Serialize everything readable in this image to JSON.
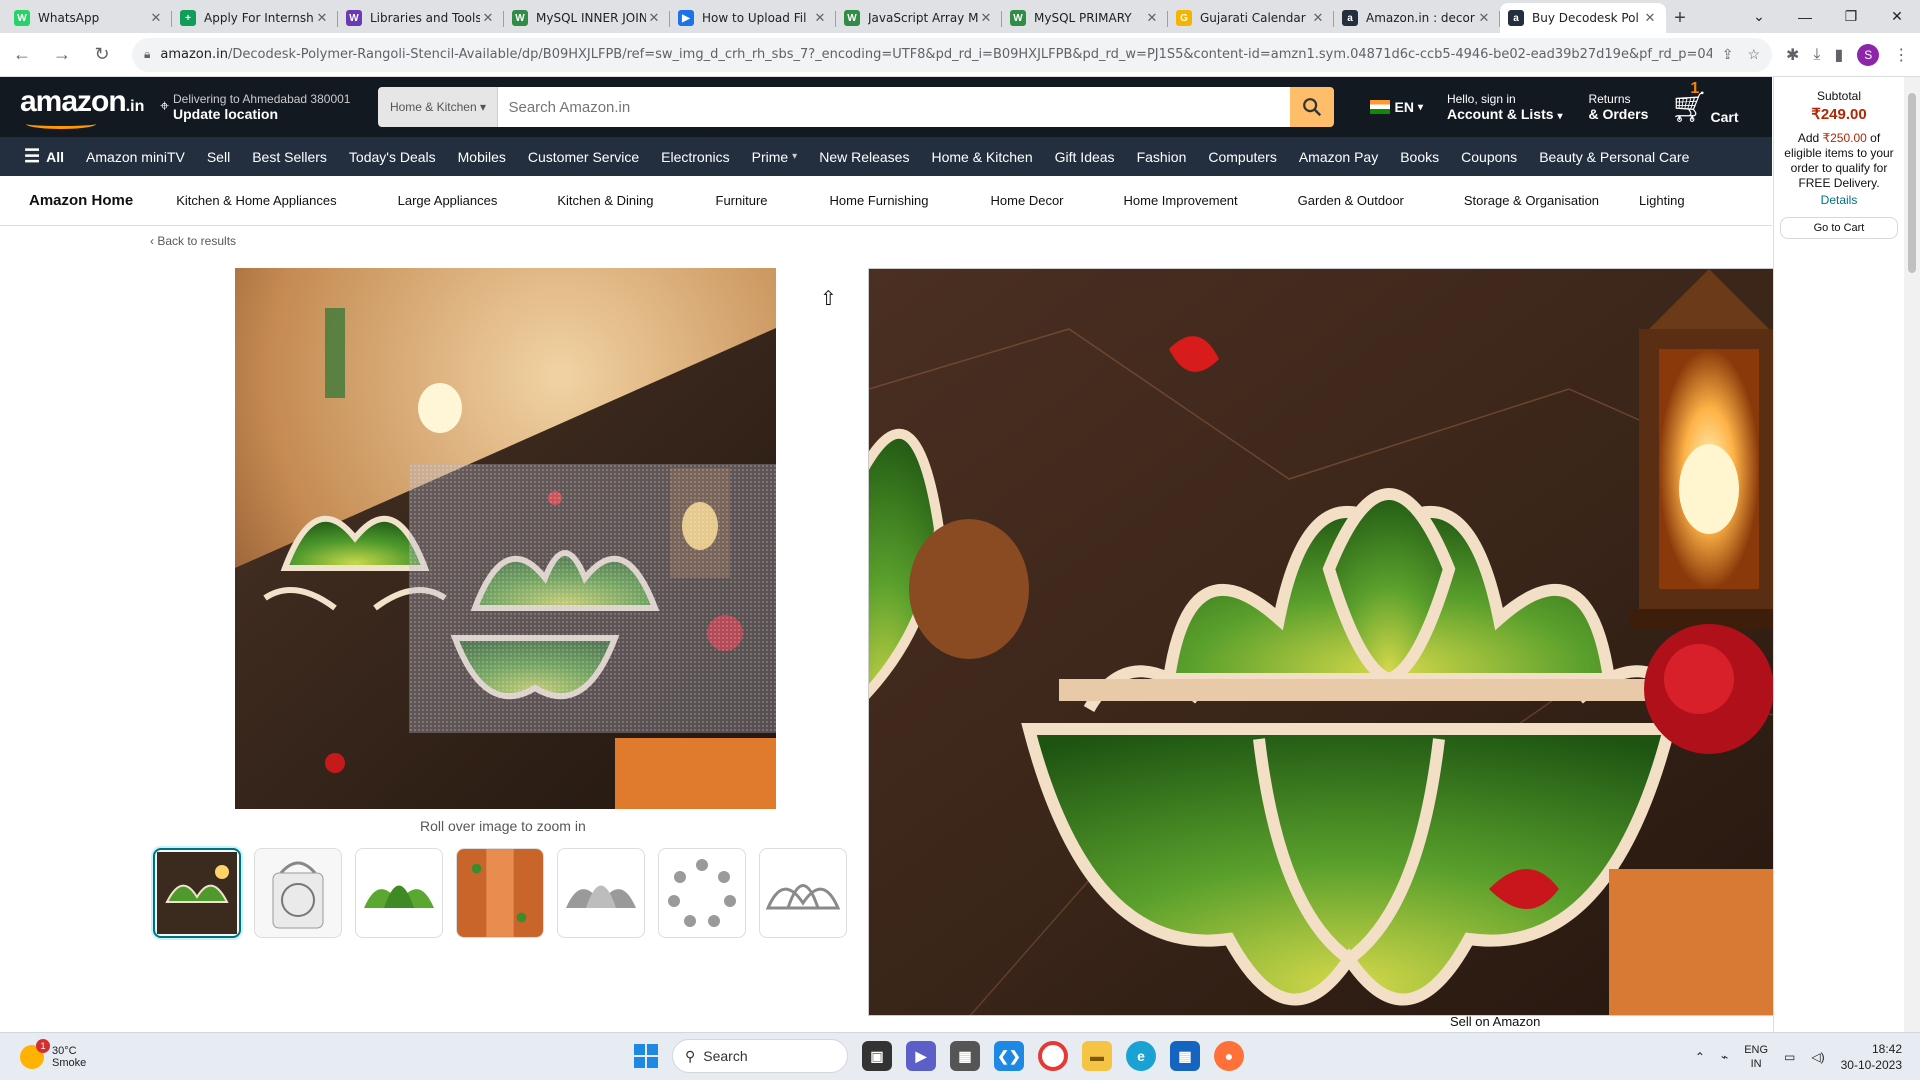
{
  "browser": {
    "tabs": [
      {
        "title": "WhatsApp",
        "color": "#25d366",
        "glyph": "W"
      },
      {
        "title": "Apply For Internsh",
        "color": "#0f9d58",
        "glyph": "+"
      },
      {
        "title": "Libraries and Tools",
        "color": "#6a3ab2",
        "glyph": "W"
      },
      {
        "title": "MySQL INNER JOIN",
        "color": "#2f8d46",
        "glyph": "W"
      },
      {
        "title": "How to Upload Fil",
        "color": "#1a73e8",
        "glyph": "▶"
      },
      {
        "title": "JavaScript Array M",
        "color": "#2f8d46",
        "glyph": "W"
      },
      {
        "title": "MySQL PRIMARY",
        "color": "#2f8d46",
        "glyph": "W"
      },
      {
        "title": "Gujarati Calendar",
        "color": "#f4b400",
        "glyph": "G"
      },
      {
        "title": "Amazon.in : decor",
        "color": "#232f3e",
        "glyph": "a"
      },
      {
        "title": "Buy Decodesk Pol",
        "color": "#232f3e",
        "glyph": "a"
      }
    ],
    "active_tab": 9,
    "url_host": "amazon.in",
    "url_path": "/Decodesk-Polymer-Rangoli-Stencil-Available/dp/B09HXJLFPB/ref=sw_img_d_crh_rh_sbs_7?_encoding=UTF8&pd_rd_i=B09HXJLFPB&pd_rd_w=PJ1S5&content-id=amzn1.sym.04871d6c-ccb5-4946-be02-ead39b27d19e&pf_rd_p=04871d6...",
    "profile_initial": "S"
  },
  "amazon": {
    "logo_text": "amazon",
    "logo_suffix": ".in",
    "deliver_line1": "Delivering to Ahmedabad 380001",
    "deliver_line2": "Update location",
    "search_category": "Home & Kitchen",
    "search_placeholder": "Search Amazon.in",
    "lang": "EN",
    "account_line1": "Hello, sign in",
    "account_line2": "Account & Lists",
    "returns_line1": "Returns",
    "returns_line2": "& Orders",
    "cart_count": "1",
    "cart_label": "Cart",
    "nav_all": "All",
    "nav_items": [
      "Amazon miniTV",
      "Sell",
      "Best Sellers",
      "Today's Deals",
      "Mobiles",
      "Customer Service",
      "Electronics",
      "Prime",
      "New Releases",
      "Home & Kitchen",
      "Gift Ideas",
      "Fashion",
      "Computers",
      "Amazon Pay",
      "Books",
      "Coupons",
      "Beauty & Personal Care"
    ],
    "subnav_home": "Amazon Home",
    "subnav_items": [
      "Kitchen & Home Appliances",
      "Large Appliances",
      "Kitchen & Dining",
      "Furniture",
      "Home Furnishing",
      "Home Decor",
      "Home Improvement",
      "Garden & Outdoor",
      "Storage & Organisation",
      "Lighting"
    ],
    "back_to_results": "‹ Back to results",
    "zoom_hint": "Roll over image to zoom in",
    "thumbnail_count": 7,
    "selected_thumbnail": 0
  },
  "cart_panel": {
    "subtotal_label": "Subtotal",
    "subtotal_amount": "₹249.00",
    "msg_prefix": "Add ",
    "msg_amount": "₹250.00",
    "msg_suffix": " of eligible items to your order to qualify for FREE Delivery.",
    "details": "Details",
    "go_to_cart": "Go to Cart"
  },
  "below_fold": {
    "sell_on_amazon": "Sell on Amazon"
  },
  "taskbar": {
    "weather_temp": "30°C",
    "weather_desc": "Smoke",
    "weather_badge": "1",
    "search_label": "Search",
    "lang_line1": "ENG",
    "lang_line2": "IN",
    "time": "18:42",
    "date": "30-10-2023"
  }
}
